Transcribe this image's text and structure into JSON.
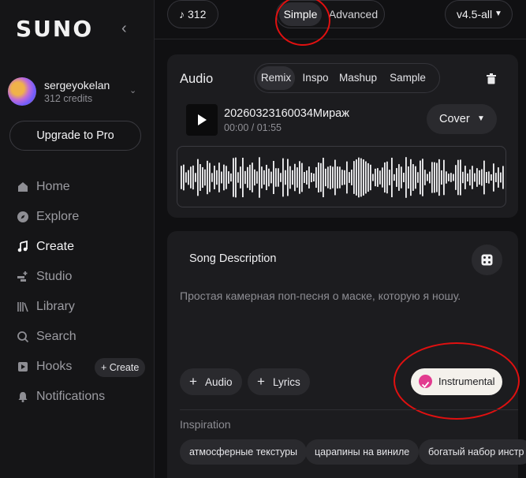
{
  "sidebar": {
    "logo": "SUNO",
    "user": {
      "name": "sergeyokelan",
      "credits": "312 credits"
    },
    "upgrade_label": "Upgrade to Pro",
    "nav": [
      {
        "label": "Home",
        "icon": "home-icon"
      },
      {
        "label": "Explore",
        "icon": "compass-icon"
      },
      {
        "label": "Create",
        "icon": "music-note-icon"
      },
      {
        "label": "Studio",
        "icon": "studio-icon"
      },
      {
        "label": "Library",
        "icon": "library-icon"
      },
      {
        "label": "Search",
        "icon": "search-icon"
      },
      {
        "label": "Hooks",
        "icon": "hooks-icon"
      },
      {
        "label": "Notifications",
        "icon": "bell-icon"
      }
    ],
    "hooks_create_label": "+ Create"
  },
  "topbar": {
    "credits": "312",
    "mode_simple": "Simple",
    "mode_advanced": "Advanced",
    "model": "v4.5-all"
  },
  "audio": {
    "title": "Audio",
    "tabs": [
      "Remix",
      "Inspo",
      "Mashup",
      "Sample"
    ],
    "track_name": "20260323160034Мираж",
    "track_time": "00:00 / 01:55",
    "cover_label": "Cover"
  },
  "description": {
    "label": "Song Description",
    "placeholder": "Простая камерная поп-песня о маске, которую я ношу.",
    "add_audio_label": "Audio",
    "add_lyrics_label": "Lyrics",
    "instrumental_label": "Instrumental",
    "inspiration_label": "Inspiration",
    "inspiration_chips": [
      "атмосферные текстуры",
      "царапины на виниле",
      "богатый набор инстр"
    ]
  },
  "colors": {
    "annotation_red": "#e01010",
    "accent_pink": "#e23b8f"
  }
}
